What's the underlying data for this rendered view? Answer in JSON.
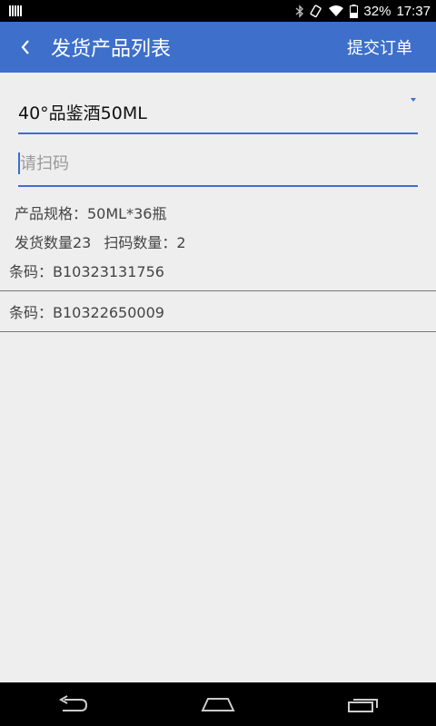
{
  "status_bar": {
    "battery": "32%",
    "time": "17:37"
  },
  "app_bar": {
    "title": "发货产品列表",
    "submit_label": "提交订单"
  },
  "product_selector": {
    "selected": "40°品鉴酒50ML"
  },
  "scan": {
    "placeholder": "请扫码",
    "value": ""
  },
  "product_info": {
    "spec": "产品规格：50ML*36瓶",
    "ship_qty": "发货数量23",
    "scan_qty": "扫码数量：2"
  },
  "barcodes": [
    {
      "label": "条码：B10323131756"
    },
    {
      "label": "条码：B10322650009"
    }
  ],
  "colors": {
    "accent": "#3d6fcb",
    "background": "#eeeeee"
  }
}
